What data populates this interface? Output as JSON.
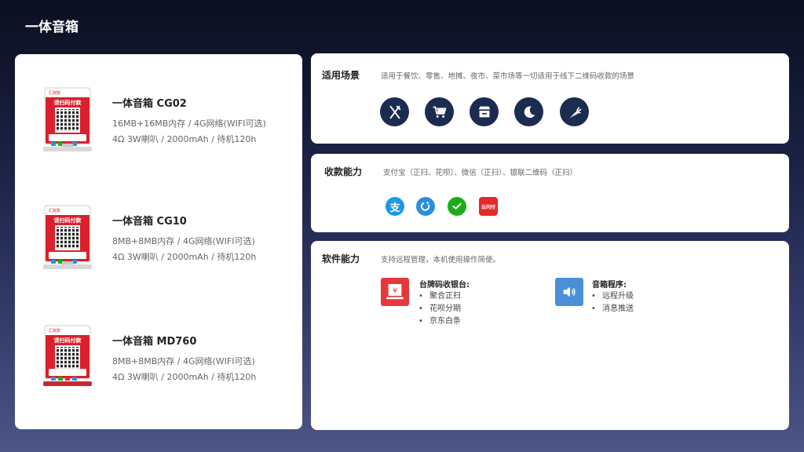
{
  "page": {
    "title": "一体音箱"
  },
  "products": [
    {
      "name": "一体音箱 CG02",
      "spec1": "16MB+16MB内存 / 4G网络(WIFI可选)",
      "spec2": "4Ω 3W喇叭 / 2000mAh / 待机120h",
      "device_brand": "汇收款",
      "device_label": "请扫码付款"
    },
    {
      "name": "一体音箱 CG10",
      "spec1": "8MB+8MB内存 / 4G网络(WIFI可选)",
      "spec2": "4Ω 3W喇叭 / 2000mAh / 待机120h",
      "device_brand": "汇收款",
      "device_label": "请扫码付款"
    },
    {
      "name": "一体音箱 MD760",
      "spec1": "8MB+8MB内存 / 4G网络(WIFI可选)",
      "spec2": "4Ω 3W喇叭 / 2000mAh / 待机120h",
      "device_brand": "汇收款",
      "device_label": "请扫码付款"
    }
  ],
  "scenes": {
    "title": "适用场景",
    "desc": "适用于餐饮、零售、地摊、夜市、菜市场等一切适用于线下二维码收款的场景",
    "icons": [
      "fork-knife-icon",
      "shopping-cart-icon",
      "stall-icon",
      "moon-icon",
      "carrot-icon"
    ],
    "icon_color": "#1c2b50"
  },
  "payment": {
    "title": "收款能力",
    "desc": "支付宝（正扫、花呗）、微信（正扫）、银联二维码（正扫）",
    "icons": [
      {
        "name": "alipay-icon",
        "glyph": "支",
        "color": "#1a9ae8"
      },
      {
        "name": "huabei-icon",
        "glyph": "",
        "color": "#2b8ee0"
      },
      {
        "name": "wechat-pay-icon",
        "glyph": "",
        "color": "#1aad19"
      },
      {
        "name": "unionpay-icon",
        "glyph": "云闪付",
        "color": "#e02b2b"
      }
    ]
  },
  "software": {
    "title": "软件能力",
    "desc": "支持远程管理，本机使用操作简便。",
    "blocks": [
      {
        "title": "台牌码收银台:",
        "items": [
          "聚合正扫",
          "花呗分期",
          "京东白条"
        ],
        "icon": "cashier-icon",
        "color": "#e4393c",
        "glyph": "¥"
      },
      {
        "title": "音箱程序:",
        "items": [
          "远程升级",
          "消息推送"
        ],
        "icon": "speaker-icon",
        "color": "#4a90d9"
      }
    ]
  }
}
